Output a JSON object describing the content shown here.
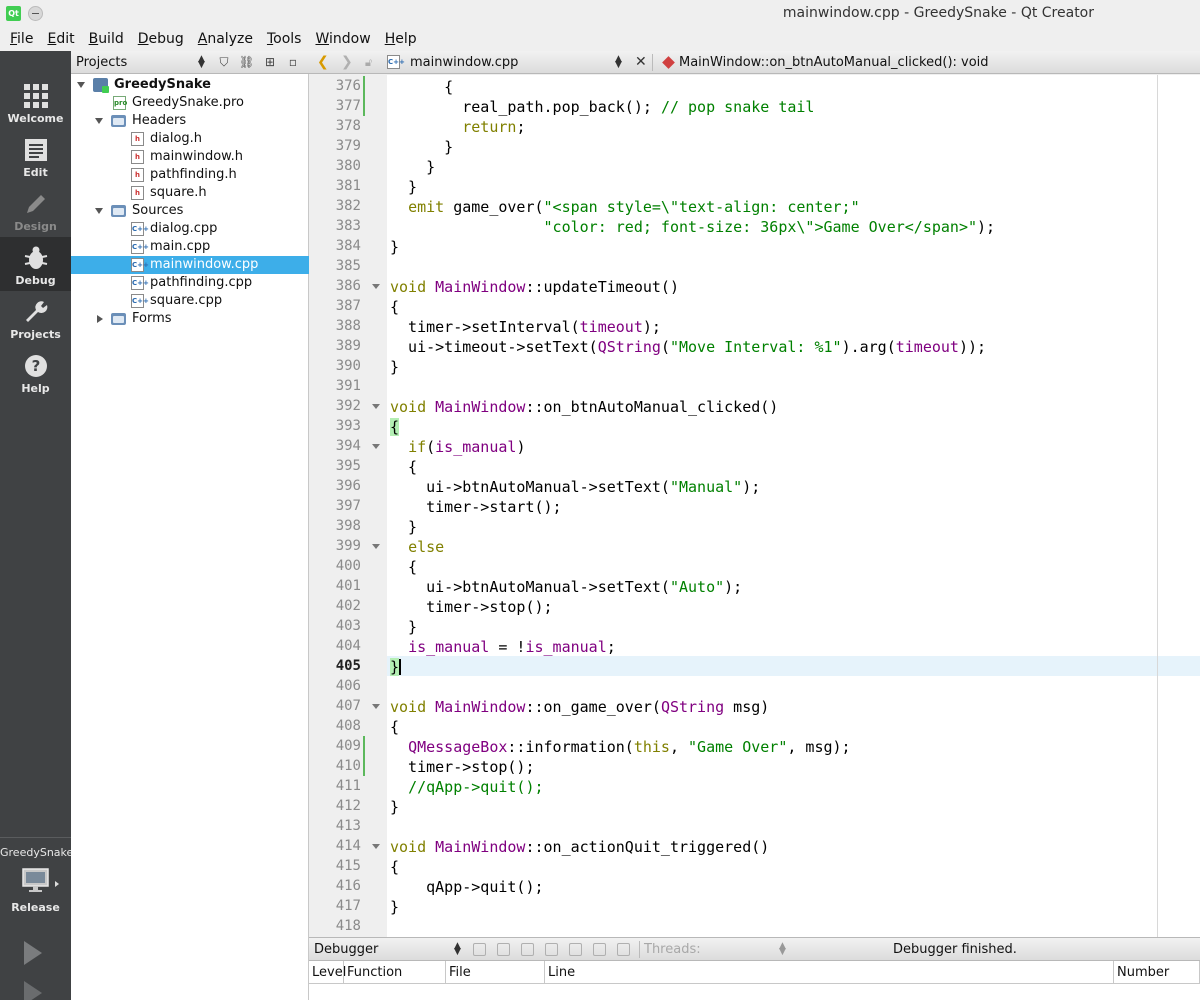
{
  "window": {
    "title": "mainwindow.cpp - GreedySnake - Qt Creator",
    "app_logo": "Qt"
  },
  "menu": [
    {
      "label": "File",
      "mnemonic": "F",
      "rest": "ile"
    },
    {
      "label": "Edit",
      "mnemonic": "E",
      "rest": "dit"
    },
    {
      "label": "Build",
      "mnemonic": "B",
      "rest": "uild"
    },
    {
      "label": "Debug",
      "mnemonic": "D",
      "rest": "ebug"
    },
    {
      "label": "Analyze",
      "mnemonic": "A",
      "rest": "nalyze"
    },
    {
      "label": "Tools",
      "mnemonic": "T",
      "rest": "ools"
    },
    {
      "label": "Window",
      "mnemonic": "W",
      "rest": "indow"
    },
    {
      "label": "Help",
      "mnemonic": "H",
      "rest": "elp"
    }
  ],
  "modes": {
    "welcome": "Welcome",
    "edit": "Edit",
    "design": "Design",
    "debug": "Debug",
    "projects": "Projects",
    "help": "Help",
    "active": "Debug"
  },
  "kit": {
    "project": "GreedySnake",
    "config": "Release"
  },
  "projects_pane": {
    "combo": "Projects",
    "tree": [
      {
        "label": "GreedySnake",
        "type": "project",
        "depth": 0,
        "expanded": true,
        "bold": true
      },
      {
        "label": "GreedySnake.pro",
        "type": "pro",
        "depth": 1
      },
      {
        "label": "Headers",
        "type": "folder",
        "depth": 1,
        "expanded": true
      },
      {
        "label": "dialog.h",
        "type": "h",
        "depth": 2
      },
      {
        "label": "mainwindow.h",
        "type": "h",
        "depth": 2
      },
      {
        "label": "pathfinding.h",
        "type": "h",
        "depth": 2
      },
      {
        "label": "square.h",
        "type": "h",
        "depth": 2
      },
      {
        "label": "Sources",
        "type": "folder",
        "depth": 1,
        "expanded": true
      },
      {
        "label": "dialog.cpp",
        "type": "cpp",
        "depth": 2
      },
      {
        "label": "main.cpp",
        "type": "cpp",
        "depth": 2
      },
      {
        "label": "mainwindow.cpp",
        "type": "cpp",
        "depth": 2,
        "selected": true
      },
      {
        "label": "pathfinding.cpp",
        "type": "cpp",
        "depth": 2
      },
      {
        "label": "square.cpp",
        "type": "cpp",
        "depth": 2
      },
      {
        "label": "Forms",
        "type": "folder",
        "depth": 1,
        "expanded": false
      }
    ]
  },
  "editor": {
    "file": "mainwindow.cpp",
    "symbol": "MainWindow::on_btnAutoManual_clicked(): void",
    "current_line": 405,
    "lines": [
      {
        "n": "376",
        "mod": true,
        "code": [
          [
            "      {",
            ""
          ]
        ]
      },
      {
        "n": "377",
        "mod": true,
        "code": [
          [
            "        real_path.pop_back(); ",
            ""
          ],
          [
            "// pop snake tail",
            "cm"
          ]
        ]
      },
      {
        "n": "378",
        "code": [
          [
            "        ",
            ""
          ],
          [
            "return",
            "kw"
          ],
          [
            ";",
            ""
          ]
        ]
      },
      {
        "n": "379",
        "code": [
          [
            "      }",
            ""
          ]
        ]
      },
      {
        "n": "380",
        "code": [
          [
            "    }",
            ""
          ]
        ]
      },
      {
        "n": "381",
        "code": [
          [
            "  }",
            ""
          ]
        ]
      },
      {
        "n": "382",
        "code": [
          [
            "  ",
            ""
          ],
          [
            "emit",
            "kw"
          ],
          [
            " game_over(",
            ""
          ],
          [
            "\"<span style=\\\"text-align: center;\"",
            "str"
          ]
        ]
      },
      {
        "n": "383",
        "code": [
          [
            "                 ",
            ""
          ],
          [
            "\"color: red; font-size: 36px\\\">Game Over</span>\"",
            "str"
          ],
          [
            ");",
            ""
          ]
        ]
      },
      {
        "n": "384",
        "code": [
          [
            "}",
            ""
          ]
        ]
      },
      {
        "n": "385",
        "code": [
          [
            "",
            ""
          ]
        ]
      },
      {
        "n": "386",
        "fold": true,
        "code": [
          [
            "void",
            "kw"
          ],
          [
            " ",
            ""
          ],
          [
            "MainWindow",
            "ty"
          ],
          [
            "::updateTimeout()",
            ""
          ]
        ]
      },
      {
        "n": "387",
        "code": [
          [
            "{",
            ""
          ]
        ]
      },
      {
        "n": "388",
        "code": [
          [
            "  timer->setInterval(",
            ""
          ],
          [
            "timeout",
            "ty"
          ],
          [
            ");",
            ""
          ]
        ]
      },
      {
        "n": "389",
        "code": [
          [
            "  ui->timeout->setText(",
            ""
          ],
          [
            "QString",
            "ty"
          ],
          [
            "(",
            ""
          ],
          [
            "\"Move Interval: %1\"",
            "str"
          ],
          [
            ").arg(",
            ""
          ],
          [
            "timeout",
            "ty"
          ],
          [
            "));",
            ""
          ]
        ]
      },
      {
        "n": "390",
        "code": [
          [
            "}",
            ""
          ]
        ]
      },
      {
        "n": "391",
        "code": [
          [
            "",
            ""
          ]
        ]
      },
      {
        "n": "392",
        "fold": true,
        "code": [
          [
            "void",
            "kw"
          ],
          [
            " ",
            ""
          ],
          [
            "MainWindow",
            "ty"
          ],
          [
            "::on_btnAutoManual_clicked()",
            ""
          ]
        ]
      },
      {
        "n": "393",
        "code": [
          [
            "{",
            "br-match"
          ]
        ]
      },
      {
        "n": "394",
        "fold": true,
        "code": [
          [
            "  ",
            ""
          ],
          [
            "if",
            "kw"
          ],
          [
            "(",
            ""
          ],
          [
            "is_manual",
            "ty"
          ],
          [
            ")",
            ""
          ]
        ]
      },
      {
        "n": "395",
        "code": [
          [
            "  {",
            ""
          ]
        ]
      },
      {
        "n": "396",
        "code": [
          [
            "    ui->btnAutoManual->setText(",
            ""
          ],
          [
            "\"Manual\"",
            "str"
          ],
          [
            ");",
            ""
          ]
        ]
      },
      {
        "n": "397",
        "code": [
          [
            "    timer->start();",
            ""
          ]
        ]
      },
      {
        "n": "398",
        "code": [
          [
            "  }",
            ""
          ]
        ]
      },
      {
        "n": "399",
        "fold": true,
        "code": [
          [
            "  ",
            ""
          ],
          [
            "else",
            "kw"
          ]
        ]
      },
      {
        "n": "400",
        "code": [
          [
            "  {",
            ""
          ]
        ]
      },
      {
        "n": "401",
        "code": [
          [
            "    ui->btnAutoManual->setText(",
            ""
          ],
          [
            "\"Auto\"",
            "str"
          ],
          [
            ");",
            ""
          ]
        ]
      },
      {
        "n": "402",
        "code": [
          [
            "    timer->stop();",
            ""
          ]
        ]
      },
      {
        "n": "403",
        "code": [
          [
            "  }",
            ""
          ]
        ]
      },
      {
        "n": "404",
        "code": [
          [
            "  ",
            ""
          ],
          [
            "is_manual",
            "ty"
          ],
          [
            " = !",
            ""
          ],
          [
            "is_manual",
            "ty"
          ],
          [
            ";",
            ""
          ]
        ]
      },
      {
        "n": "405",
        "current": true,
        "code": [
          [
            "}",
            "br-match"
          ]
        ]
      },
      {
        "n": "406",
        "code": [
          [
            "",
            ""
          ]
        ]
      },
      {
        "n": "407",
        "fold": true,
        "code": [
          [
            "void",
            "kw"
          ],
          [
            " ",
            ""
          ],
          [
            "MainWindow",
            "ty"
          ],
          [
            "::on_game_over(",
            ""
          ],
          [
            "QString",
            "ty"
          ],
          [
            " msg)",
            ""
          ]
        ]
      },
      {
        "n": "408",
        "code": [
          [
            "{",
            ""
          ]
        ]
      },
      {
        "n": "409",
        "mod": true,
        "code": [
          [
            "  ",
            ""
          ],
          [
            "QMessageBox",
            "ty"
          ],
          [
            "::information(",
            ""
          ],
          [
            "this",
            "kw"
          ],
          [
            ", ",
            ""
          ],
          [
            "\"Game Over\"",
            "str"
          ],
          [
            ", msg);",
            ""
          ]
        ]
      },
      {
        "n": "410",
        "mod": true,
        "code": [
          [
            "  timer->stop();",
            ""
          ]
        ]
      },
      {
        "n": "411",
        "code": [
          [
            "  ",
            ""
          ],
          [
            "//qApp->quit();",
            "cm"
          ]
        ]
      },
      {
        "n": "412",
        "code": [
          [
            "}",
            ""
          ]
        ]
      },
      {
        "n": "413",
        "code": [
          [
            "",
            ""
          ]
        ]
      },
      {
        "n": "414",
        "fold": true,
        "code": [
          [
            "void",
            "kw"
          ],
          [
            " ",
            ""
          ],
          [
            "MainWindow",
            "ty"
          ],
          [
            "::on_actionQuit_triggered()",
            ""
          ]
        ]
      },
      {
        "n": "415",
        "code": [
          [
            "{",
            ""
          ]
        ]
      },
      {
        "n": "416",
        "code": [
          [
            "    qApp->quit();",
            ""
          ]
        ]
      },
      {
        "n": "417",
        "code": [
          [
            "}",
            ""
          ]
        ]
      },
      {
        "n": "418",
        "code": [
          [
            "",
            ""
          ]
        ]
      }
    ]
  },
  "debugger": {
    "combo": "Debugger",
    "threads_placeholder": "Threads:",
    "status": "Debugger finished.",
    "columns": [
      "Level",
      "Function",
      "File",
      "Line",
      "Number"
    ]
  },
  "colors": {
    "keyword": "#808000",
    "type": "#800080",
    "string": "#008000",
    "comment": "#008000",
    "selection": "#3daee9",
    "mode_bar": "#404244"
  }
}
